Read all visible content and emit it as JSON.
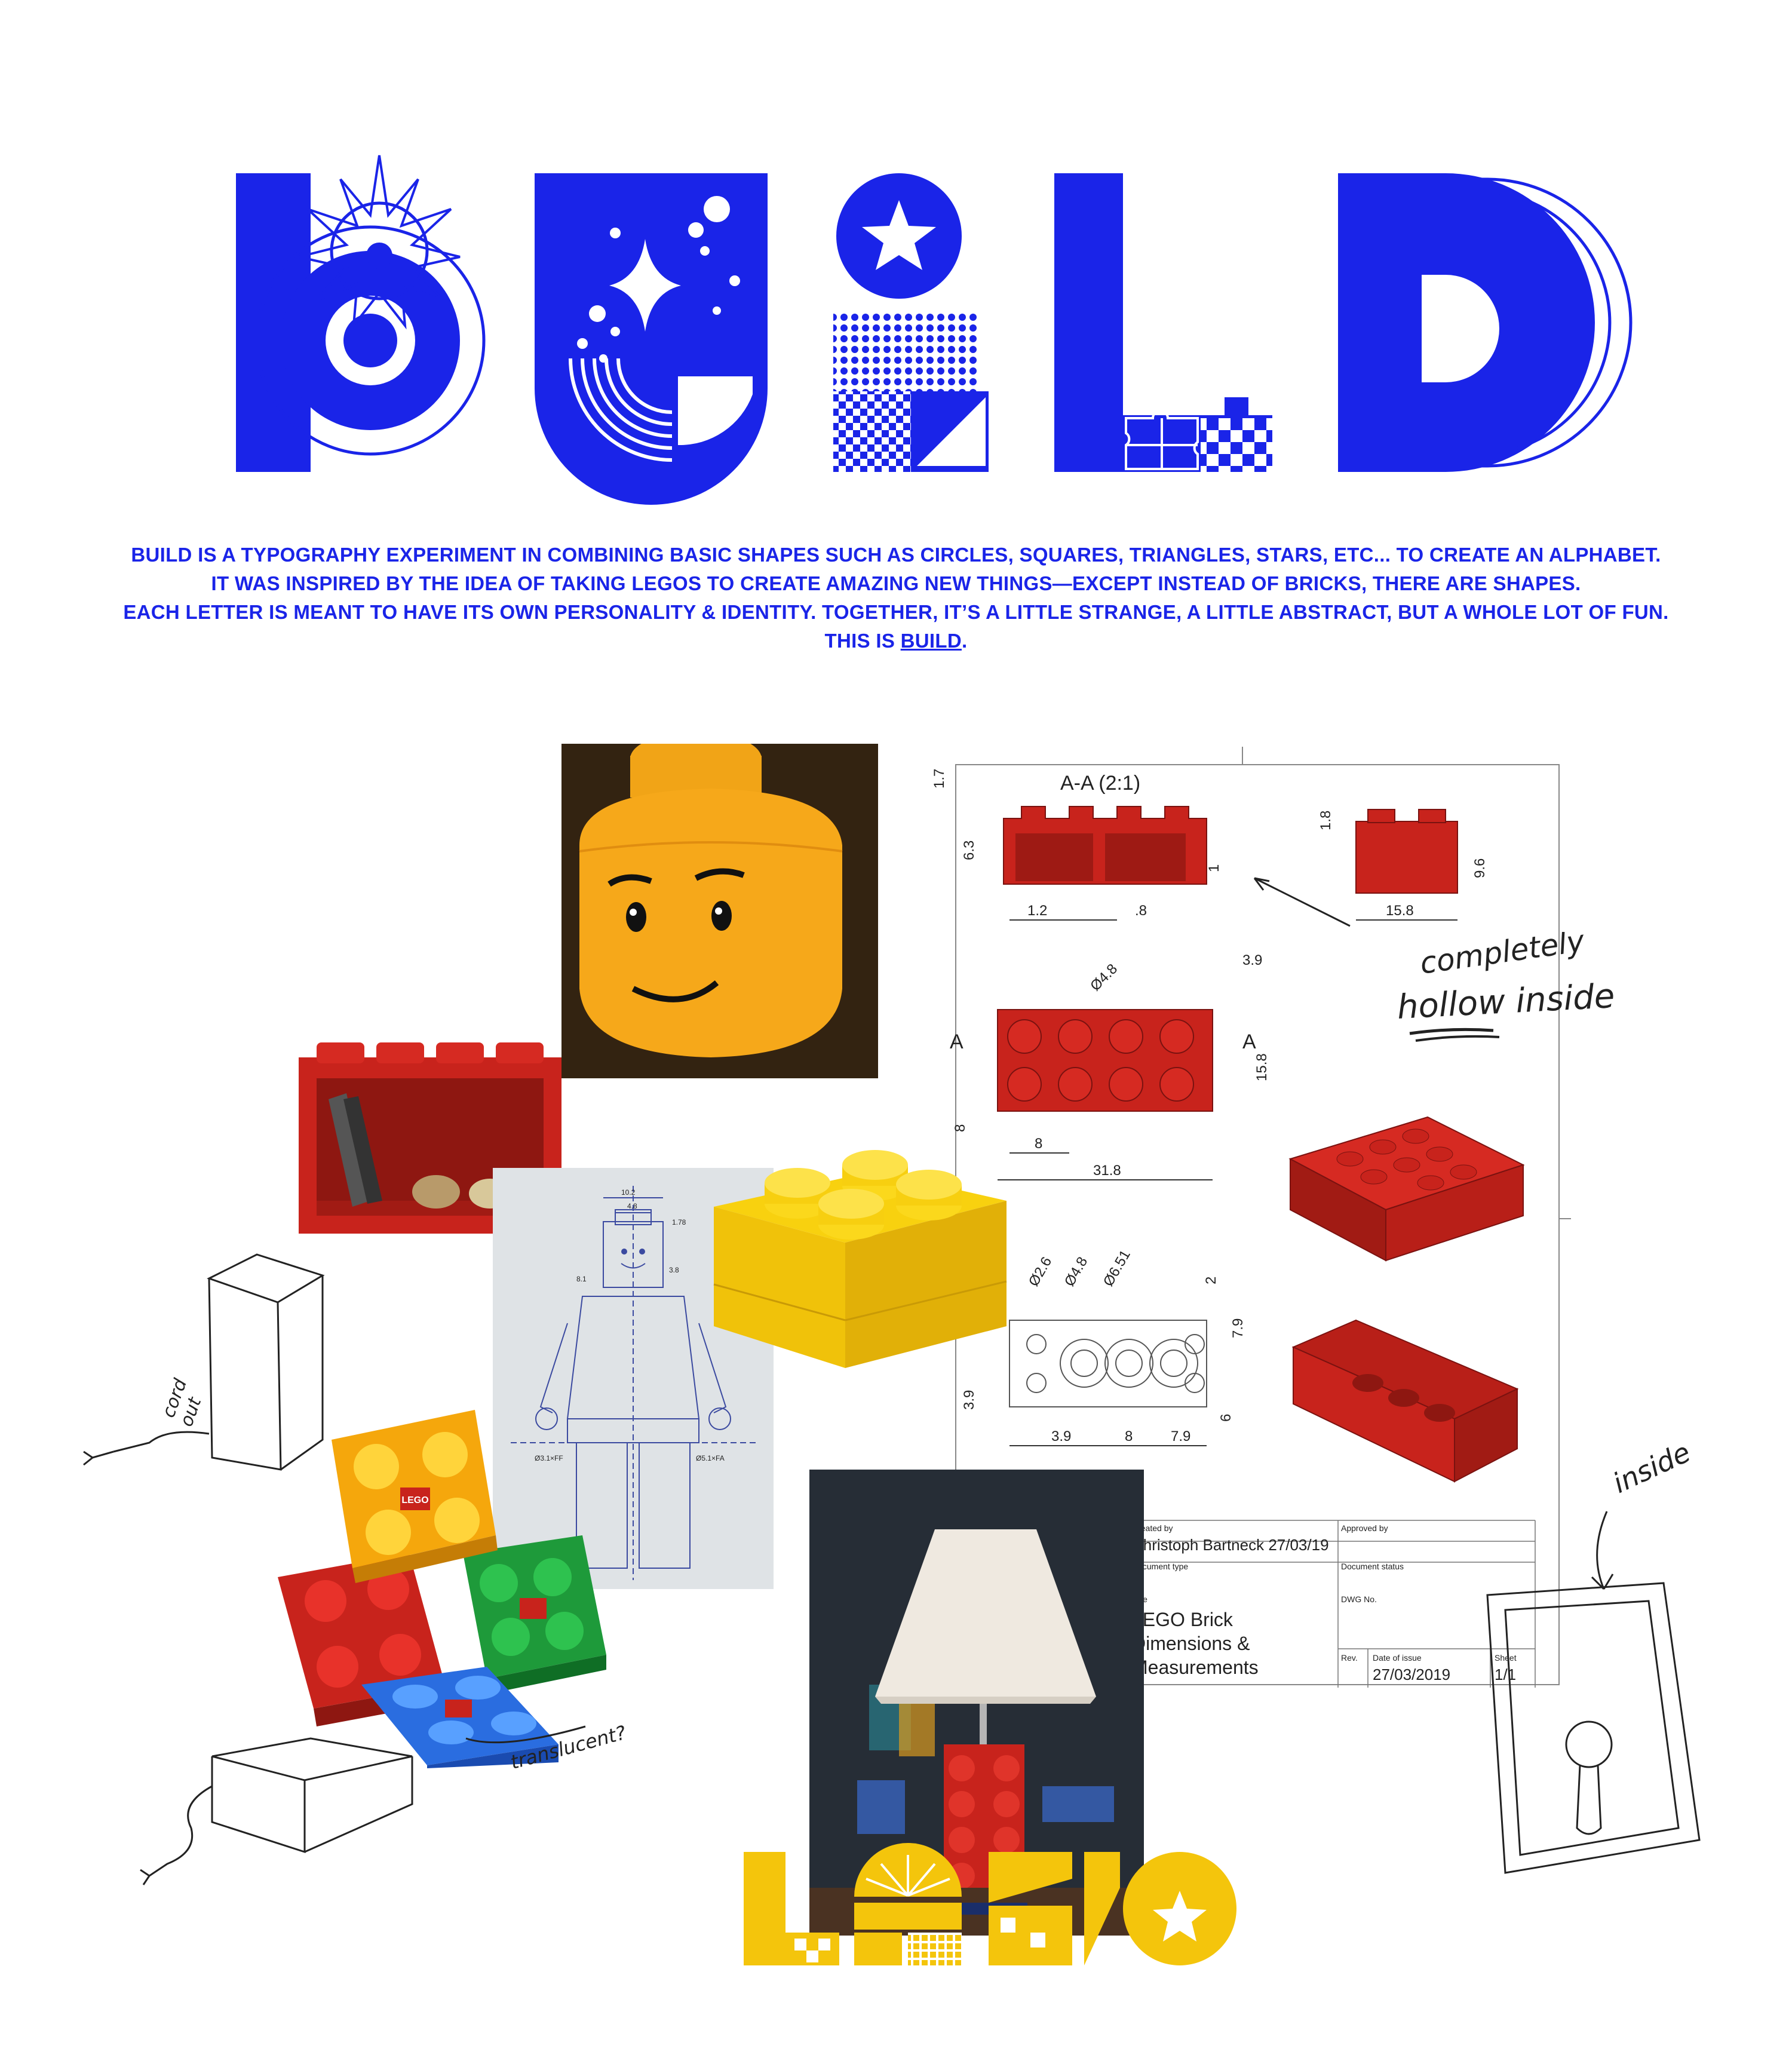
{
  "colors": {
    "brand_blue": "#1a24e8",
    "lego_yellow": "#f4c50c",
    "brick_red": "#c8231c"
  },
  "intro": {
    "line1": "BUILD IS A TYPOGRAPHY EXPERIMENT IN COMBINING BASIC SHAPES SUCH AS CIRCLES, SQUARES, TRIANGLES, STARS, ETC... TO CREATE AN ALPHABET.",
    "line2": "IT WAS INSPIRED BY THE IDEA OF TAKING LEGOS TO CREATE AMAZING NEW THINGS—EXCEPT INSTEAD OF BRICKS, THERE ARE SHAPES.",
    "line3": "EACH LETTER IS MEANT TO HAVE ITS OWN PERSONALITY & IDENTITY. TOGETHER, IT’S A LITTLE STRANGE, A LITTLE ABSTRACT, BUT A WHOLE LOT OF FUN.",
    "line4_prefix": "THIS IS ",
    "line4_link": "BUILD",
    "line4_suffix": "."
  },
  "drawing": {
    "section_label": "A-A (2:1)",
    "dims": {
      "d1_7": "1.7",
      "d6_3": "6.3",
      "d1": "1",
      "d1_2": "1.2",
      "d0_8": ".8",
      "d1_8": "1.8",
      "d9_6": "9.6",
      "d15_8": "15.8",
      "d3_9": "3.9",
      "d4_8": "Ø4.8",
      "a_left": "A",
      "a_right": "A",
      "d15_8v": "15.8",
      "d8v": "8",
      "d8": "8",
      "d31_8": "31.8",
      "d2_6": "Ø2.6",
      "d4_8b": "Ø4.8",
      "d6_51": "Ø6.51",
      "d2": "2",
      "d7_9v": "7.9",
      "d3_9v": "3.9",
      "d6": "6",
      "d3_9b": "3.9",
      "d8b": "8",
      "d7_9": "7.9"
    },
    "title_block": {
      "created_by_label": "Created by",
      "created_by": "Christoph Bartneck 27/03/19",
      "approved_by_label": "Approved by",
      "doc_type_label": "Document type",
      "doc_status_label": "Document status",
      "title_label": "Title",
      "dwg_no_label": "DWG No.",
      "title_line1": "LEGO Brick",
      "title_line2": "Dimensions &",
      "title_line3": "Measurements",
      "rev_label": "Rev.",
      "date_label": "Date of issue",
      "date": "27/03/2019",
      "sheet_label": "Sheet",
      "sheet": "1/1"
    }
  },
  "figure_blueprint": {
    "d10_2": "10.2",
    "d4_8": "4.8",
    "d1_78": "1.78",
    "d3_8": "3.8",
    "d8_1": "8.1",
    "d_left": "Ø3.1×FF",
    "d_right": "Ø5.1×FA"
  },
  "annotations": {
    "hollow_1": "completely",
    "hollow_2": "hollow inside",
    "cord": "cord",
    "out": "out",
    "translucent": "translucent?",
    "inside": "inside"
  },
  "lego_logo_text": "LEGO",
  "logo": {
    "word": "LEGO"
  }
}
